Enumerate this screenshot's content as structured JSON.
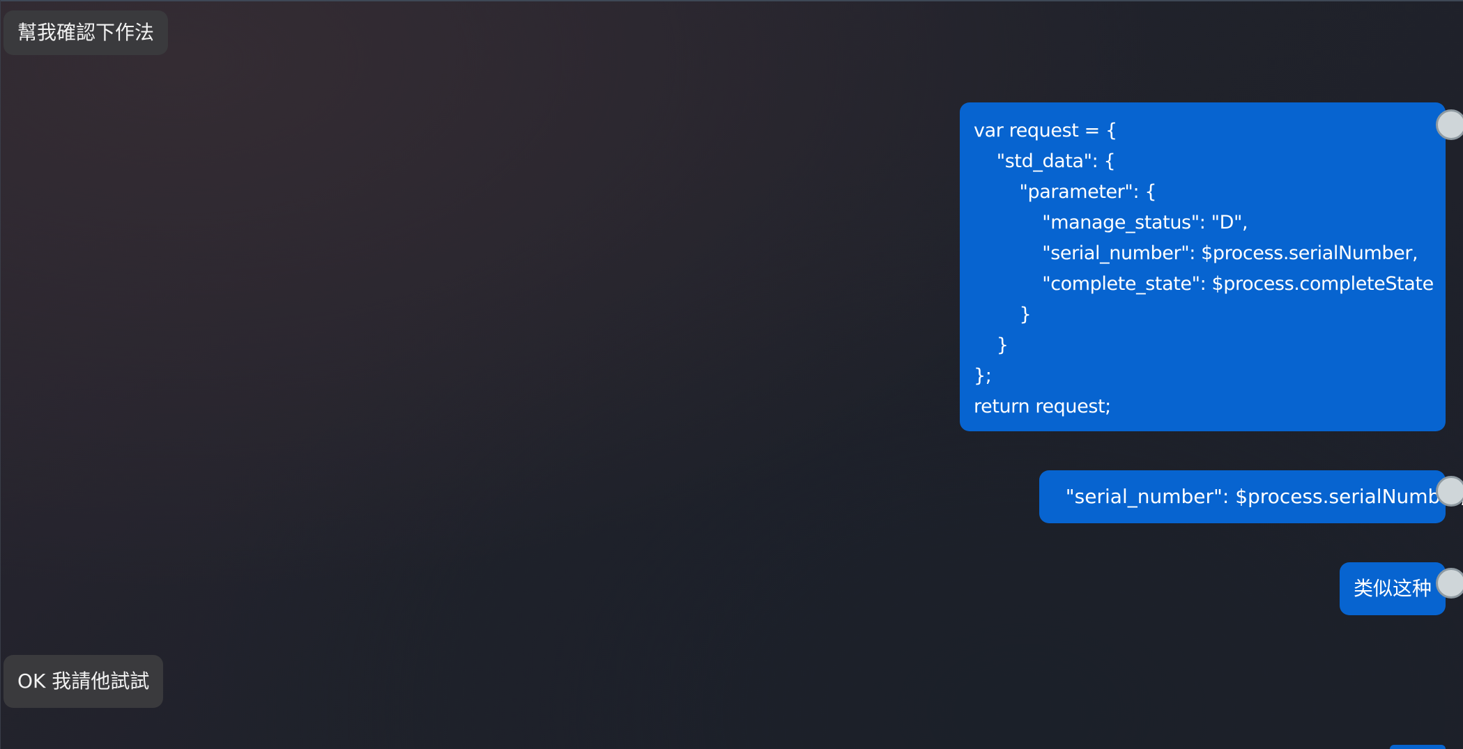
{
  "messages": [
    {
      "id": "m1",
      "side": "incoming",
      "text": "幫我確認下作法"
    },
    {
      "id": "m2",
      "side": "outgoing",
      "code_lines": [
        "var request = {",
        "    \"std_data\": {",
        "        \"parameter\": {",
        "            \"manage_status\": \"D\",",
        "            \"serial_number\": $process.serialNumber,",
        "            \"complete_state\": $process.completeState",
        "        }",
        "    }",
        "};",
        "return request;"
      ]
    },
    {
      "id": "m3",
      "side": "outgoing",
      "text": "  \"serial_number\": $process.serialNumber,"
    },
    {
      "id": "m4",
      "side": "outgoing",
      "text": "类似这种"
    },
    {
      "id": "m5",
      "side": "incoming",
      "text": "OK 我請他試試"
    }
  ],
  "colors": {
    "incoming_bubble": "#3a3a3d",
    "outgoing_bubble": "#0764d0",
    "background": "#22232c"
  }
}
